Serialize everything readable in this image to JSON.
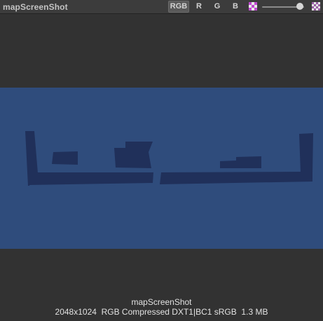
{
  "window": {
    "title": "mapScreenShot"
  },
  "toolbar": {
    "channels": [
      {
        "label": "RGB",
        "active": true
      },
      {
        "label": "R",
        "active": false
      },
      {
        "label": "G",
        "active": false
      },
      {
        "label": "B",
        "active": false
      }
    ],
    "icons": {
      "alpha_toggle": "alpha-checker-icon",
      "mip_toggle": "checker-pattern-icon"
    },
    "slider_level": 0.9
  },
  "preview": {
    "background_color": "#2f4c7c",
    "shape_color": "#20305a"
  },
  "footer": {
    "asset_name": "mapScreenShot",
    "info": "2048x1024  RGB Compressed DXT1|BC1 sRGB  1.3 MB"
  }
}
